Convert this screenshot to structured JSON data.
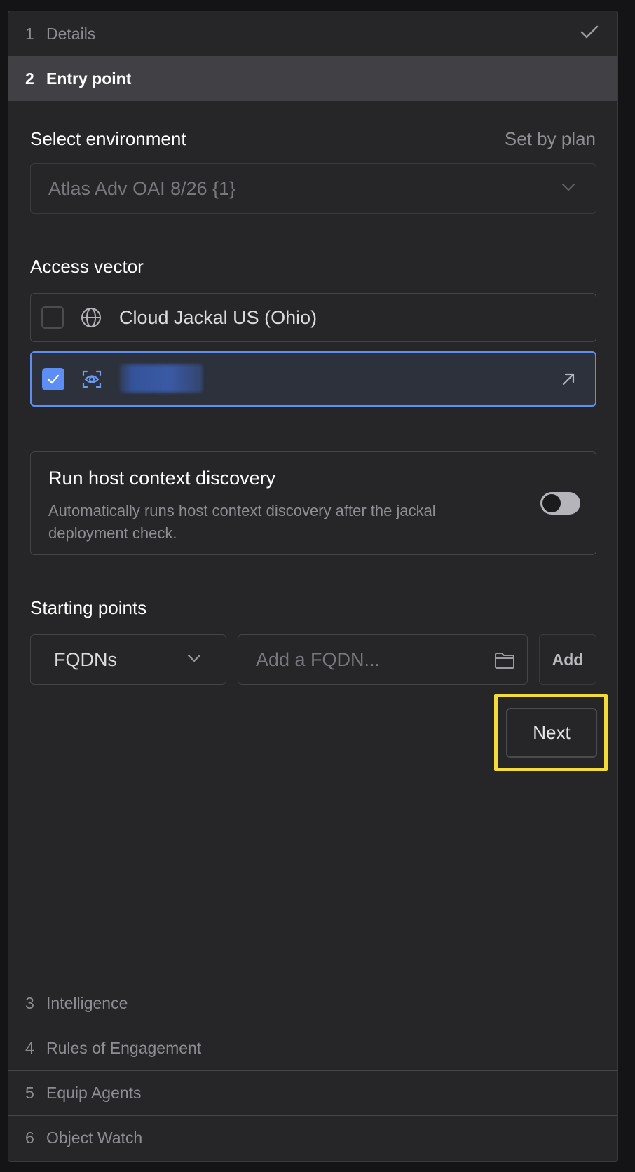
{
  "steps": [
    {
      "num": "1",
      "label": "Details",
      "status": "completed",
      "icon": "check-icon"
    },
    {
      "num": "2",
      "label": "Entry point",
      "status": "active"
    },
    {
      "num": "3",
      "label": "Intelligence",
      "status": "pending"
    },
    {
      "num": "4",
      "label": "Rules of Engagement",
      "status": "pending"
    },
    {
      "num": "5",
      "label": "Equip Agents",
      "status": "pending"
    },
    {
      "num": "6",
      "label": "Object Watch",
      "status": "pending"
    }
  ],
  "environment": {
    "label": "Select environment",
    "hint": "Set by plan",
    "value": "Atlas Adv OAI 8/26 {1}",
    "icon": "chevron-down-icon"
  },
  "access_vector": {
    "label": "Access vector",
    "options": [
      {
        "label": "Cloud Jackal US (Ohio)",
        "checked": false,
        "icon": "globe-icon"
      },
      {
        "label": "",
        "checked": true,
        "icon": "eye-scan-icon",
        "redacted": true,
        "action_icon": "arrow-up-right-icon"
      }
    ]
  },
  "discovery": {
    "title": "Run host context discovery",
    "description": "Automatically runs host context discovery after the jackal deployment check.",
    "enabled": false
  },
  "starting_points": {
    "label": "Starting points",
    "type_value": "FQDNs",
    "input_placeholder": "Add a FQDN...",
    "add_label": "Add",
    "folder_icon": "folder-icon"
  },
  "next_label": "Next",
  "colors": {
    "accent": "#5c8ef5",
    "highlight": "#f3db3a",
    "panel": "#262628",
    "active_step": "#404045"
  }
}
